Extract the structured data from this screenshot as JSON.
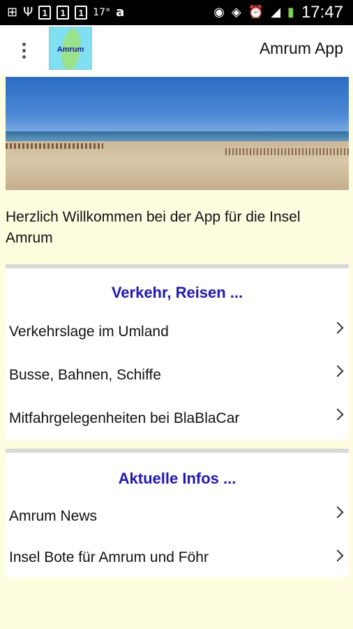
{
  "status_bar": {
    "sim1": "1",
    "sim2": "1",
    "sim3": "1",
    "temperature": "17°",
    "time": "17:47"
  },
  "appbar": {
    "logo_text": "Amrum",
    "title": "Amrum App"
  },
  "welcome": "Herzlich Willkommen bei der App für die Insel Amrum",
  "sections": [
    {
      "header": "Verkehr, Reisen ...",
      "items": [
        {
          "label": "Verkehrslage im Umland"
        },
        {
          "label": "Busse, Bahnen, Schiffe"
        },
        {
          "label": "Mitfahrgelegenheiten bei BlaBlaCar"
        }
      ]
    },
    {
      "header": "Aktuelle Infos ...",
      "items": [
        {
          "label": "Amrum News"
        },
        {
          "label": "Insel Bote für Amrum und Föhr"
        }
      ]
    }
  ]
}
